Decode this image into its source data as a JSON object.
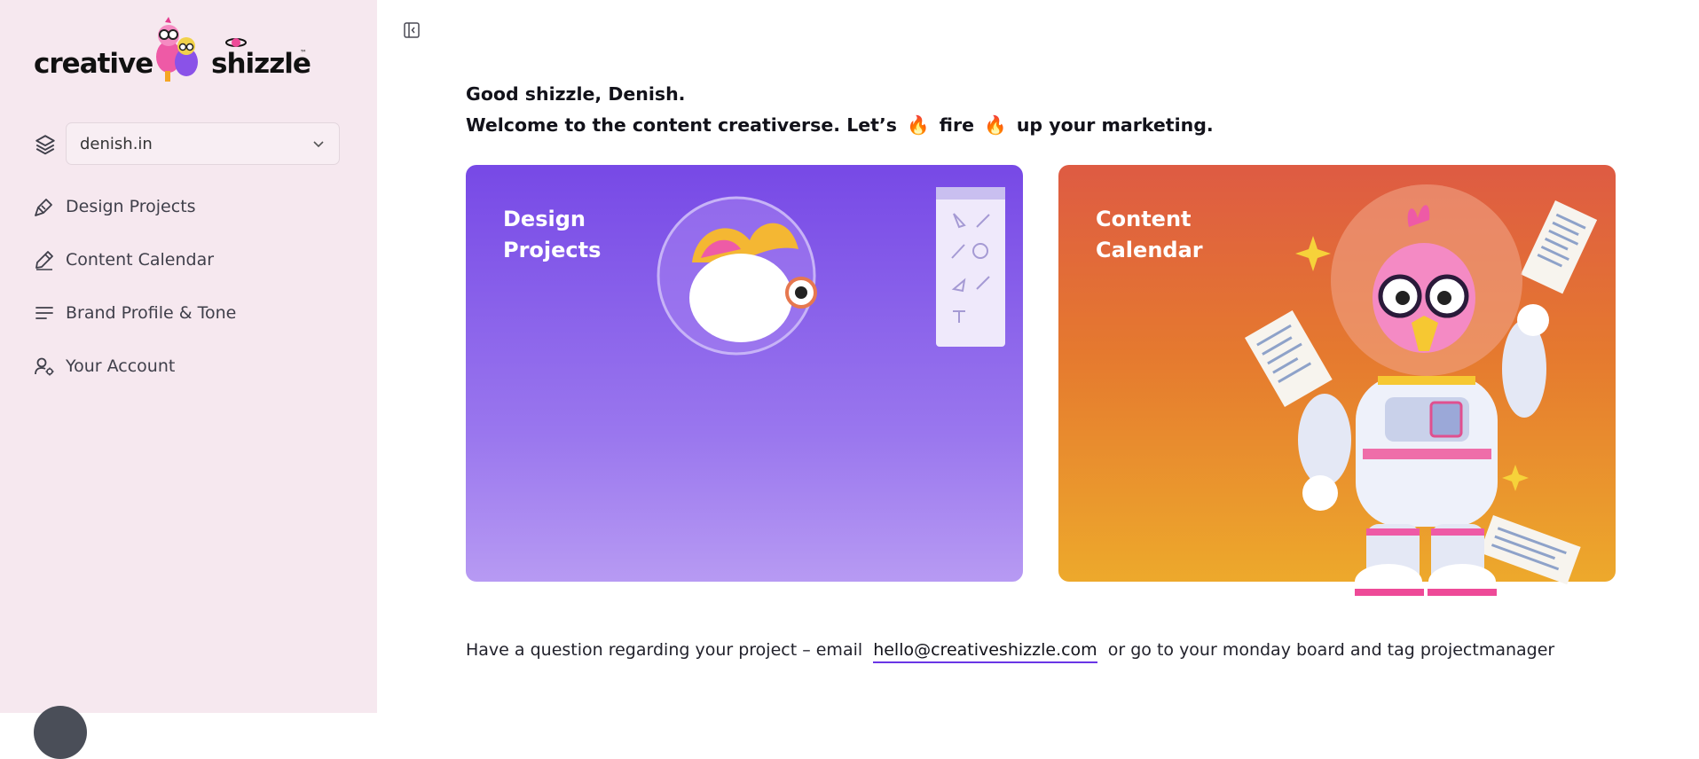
{
  "brand": {
    "left_text": "creative",
    "right_text": "shizzle",
    "trademark": "™"
  },
  "sidebar": {
    "org_select": {
      "value": "denish.in"
    },
    "items": [
      {
        "label": "Design Projects",
        "icon": "brush-icon"
      },
      {
        "label": "Content Calendar",
        "icon": "pencil-icon"
      },
      {
        "label": "Brand Profile & Tone",
        "icon": "lines-icon"
      },
      {
        "label": "Your Account",
        "icon": "user-gear-icon"
      }
    ]
  },
  "greeting": {
    "line1": "Good shizzle, Denish.",
    "line2_a": "Welcome to the content creativerse. Let’s",
    "line2_b": "fire",
    "line2_c": "up your marketing.",
    "emoji": "🔥"
  },
  "cards": [
    {
      "title_1": "Design",
      "title_2": "Projects"
    },
    {
      "title_1": "Content",
      "title_2": "Calendar"
    }
  ],
  "footer": {
    "text_before": "Have a question regarding your project – email",
    "email": "hello@creativeshizzle.com",
    "text_after": "or go to your monday board and tag projectmanager"
  },
  "colors": {
    "sidebar_bg": "#f6e8ef",
    "design_card": "#7749e6",
    "content_card": "#de5b43",
    "link_underline": "#6a35e6"
  }
}
